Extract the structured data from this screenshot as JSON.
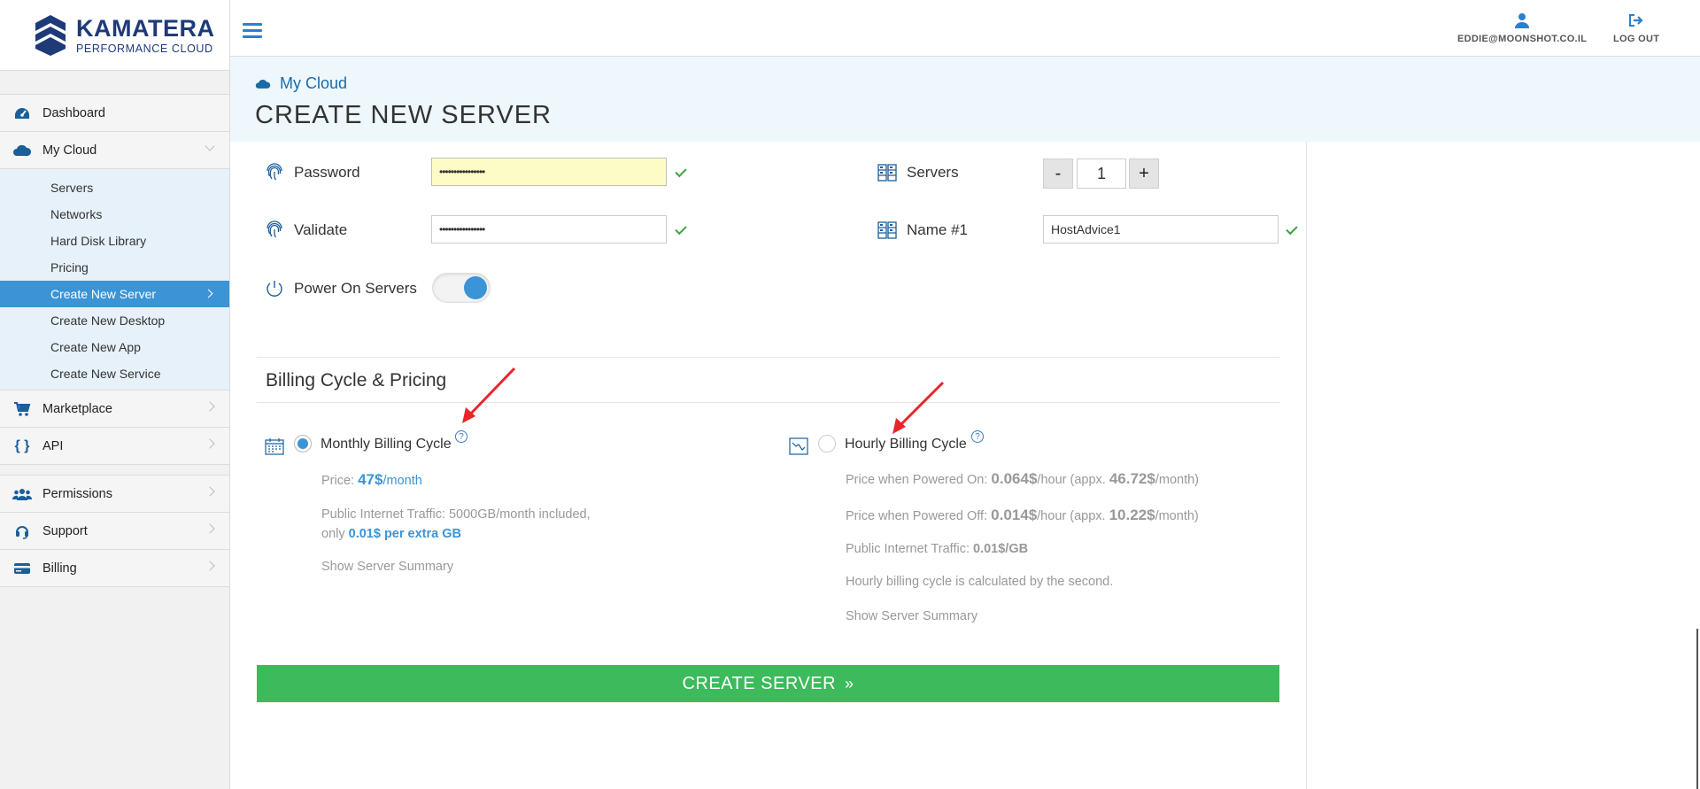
{
  "brand": {
    "name": "KAMATERA",
    "tagline": "PERFORMANCE CLOUD"
  },
  "header": {
    "user_email": "EDDIE@MOONSHOT.CO.IL",
    "logout_label": "LOG OUT"
  },
  "sidebar": {
    "items": [
      {
        "label": "Dashboard"
      },
      {
        "label": "My Cloud"
      },
      {
        "label": "Marketplace"
      },
      {
        "label": "API"
      },
      {
        "label": "Permissions"
      },
      {
        "label": "Support"
      },
      {
        "label": "Billing"
      }
    ],
    "my_cloud_sub": [
      {
        "label": "Servers"
      },
      {
        "label": "Networks"
      },
      {
        "label": "Hard Disk Library"
      },
      {
        "label": "Pricing"
      },
      {
        "label": "Create New Server",
        "active": true
      },
      {
        "label": "Create New Desktop"
      },
      {
        "label": "Create New App"
      },
      {
        "label": "Create New Service"
      }
    ]
  },
  "page": {
    "breadcrumb": "My Cloud",
    "title": "CREATE NEW SERVER"
  },
  "form": {
    "password_label": "Password",
    "password_value": "••••••••••••••••",
    "validate_label": "Validate",
    "validate_value": "••••••••••••••••",
    "power_label": "Power On Servers",
    "power_on": true,
    "servers_label": "Servers",
    "servers_count": "1",
    "minus": "-",
    "plus": "+",
    "name_label": "Name #1",
    "name_value": "HostAdvice1"
  },
  "billing": {
    "section_title": "Billing Cycle & Pricing",
    "monthly": {
      "label": "Monthly Billing Cycle",
      "selected": true,
      "price_prefix": "Price: ",
      "price_value": "47$",
      "price_unit": "/month",
      "traffic_line1": "Public Internet Traffic: 5000GB/month included,",
      "traffic_line2_prefix": "only ",
      "traffic_line2_value": "0.01$ per extra GB",
      "summary_link": "Show Server Summary"
    },
    "hourly": {
      "label": "Hourly Billing Cycle",
      "selected": false,
      "on_prefix": "Price when Powered On: ",
      "on_value": "0.064$",
      "on_mid": "/hour (appx. ",
      "on_month": "46.72$",
      "on_suffix": "/month)",
      "off_prefix": "Price when Powered Off: ",
      "off_value": "0.014$",
      "off_mid": "/hour (appx. ",
      "off_month": "10.22$",
      "off_suffix": "/month)",
      "traffic_prefix": "Public Internet Traffic: ",
      "traffic_value": "0.01$",
      "traffic_suffix": "/GB",
      "note": "Hourly billing cycle is calculated by the second.",
      "summary_link": "Show Server Summary"
    },
    "help_glyph": "?"
  },
  "cta": {
    "label": "CREATE SERVER",
    "glyph": "»"
  },
  "colors": {
    "accent": "#3a94d6",
    "cta": "#3cba5c",
    "brand": "#1e3a78",
    "arrow": "#e8262a"
  }
}
